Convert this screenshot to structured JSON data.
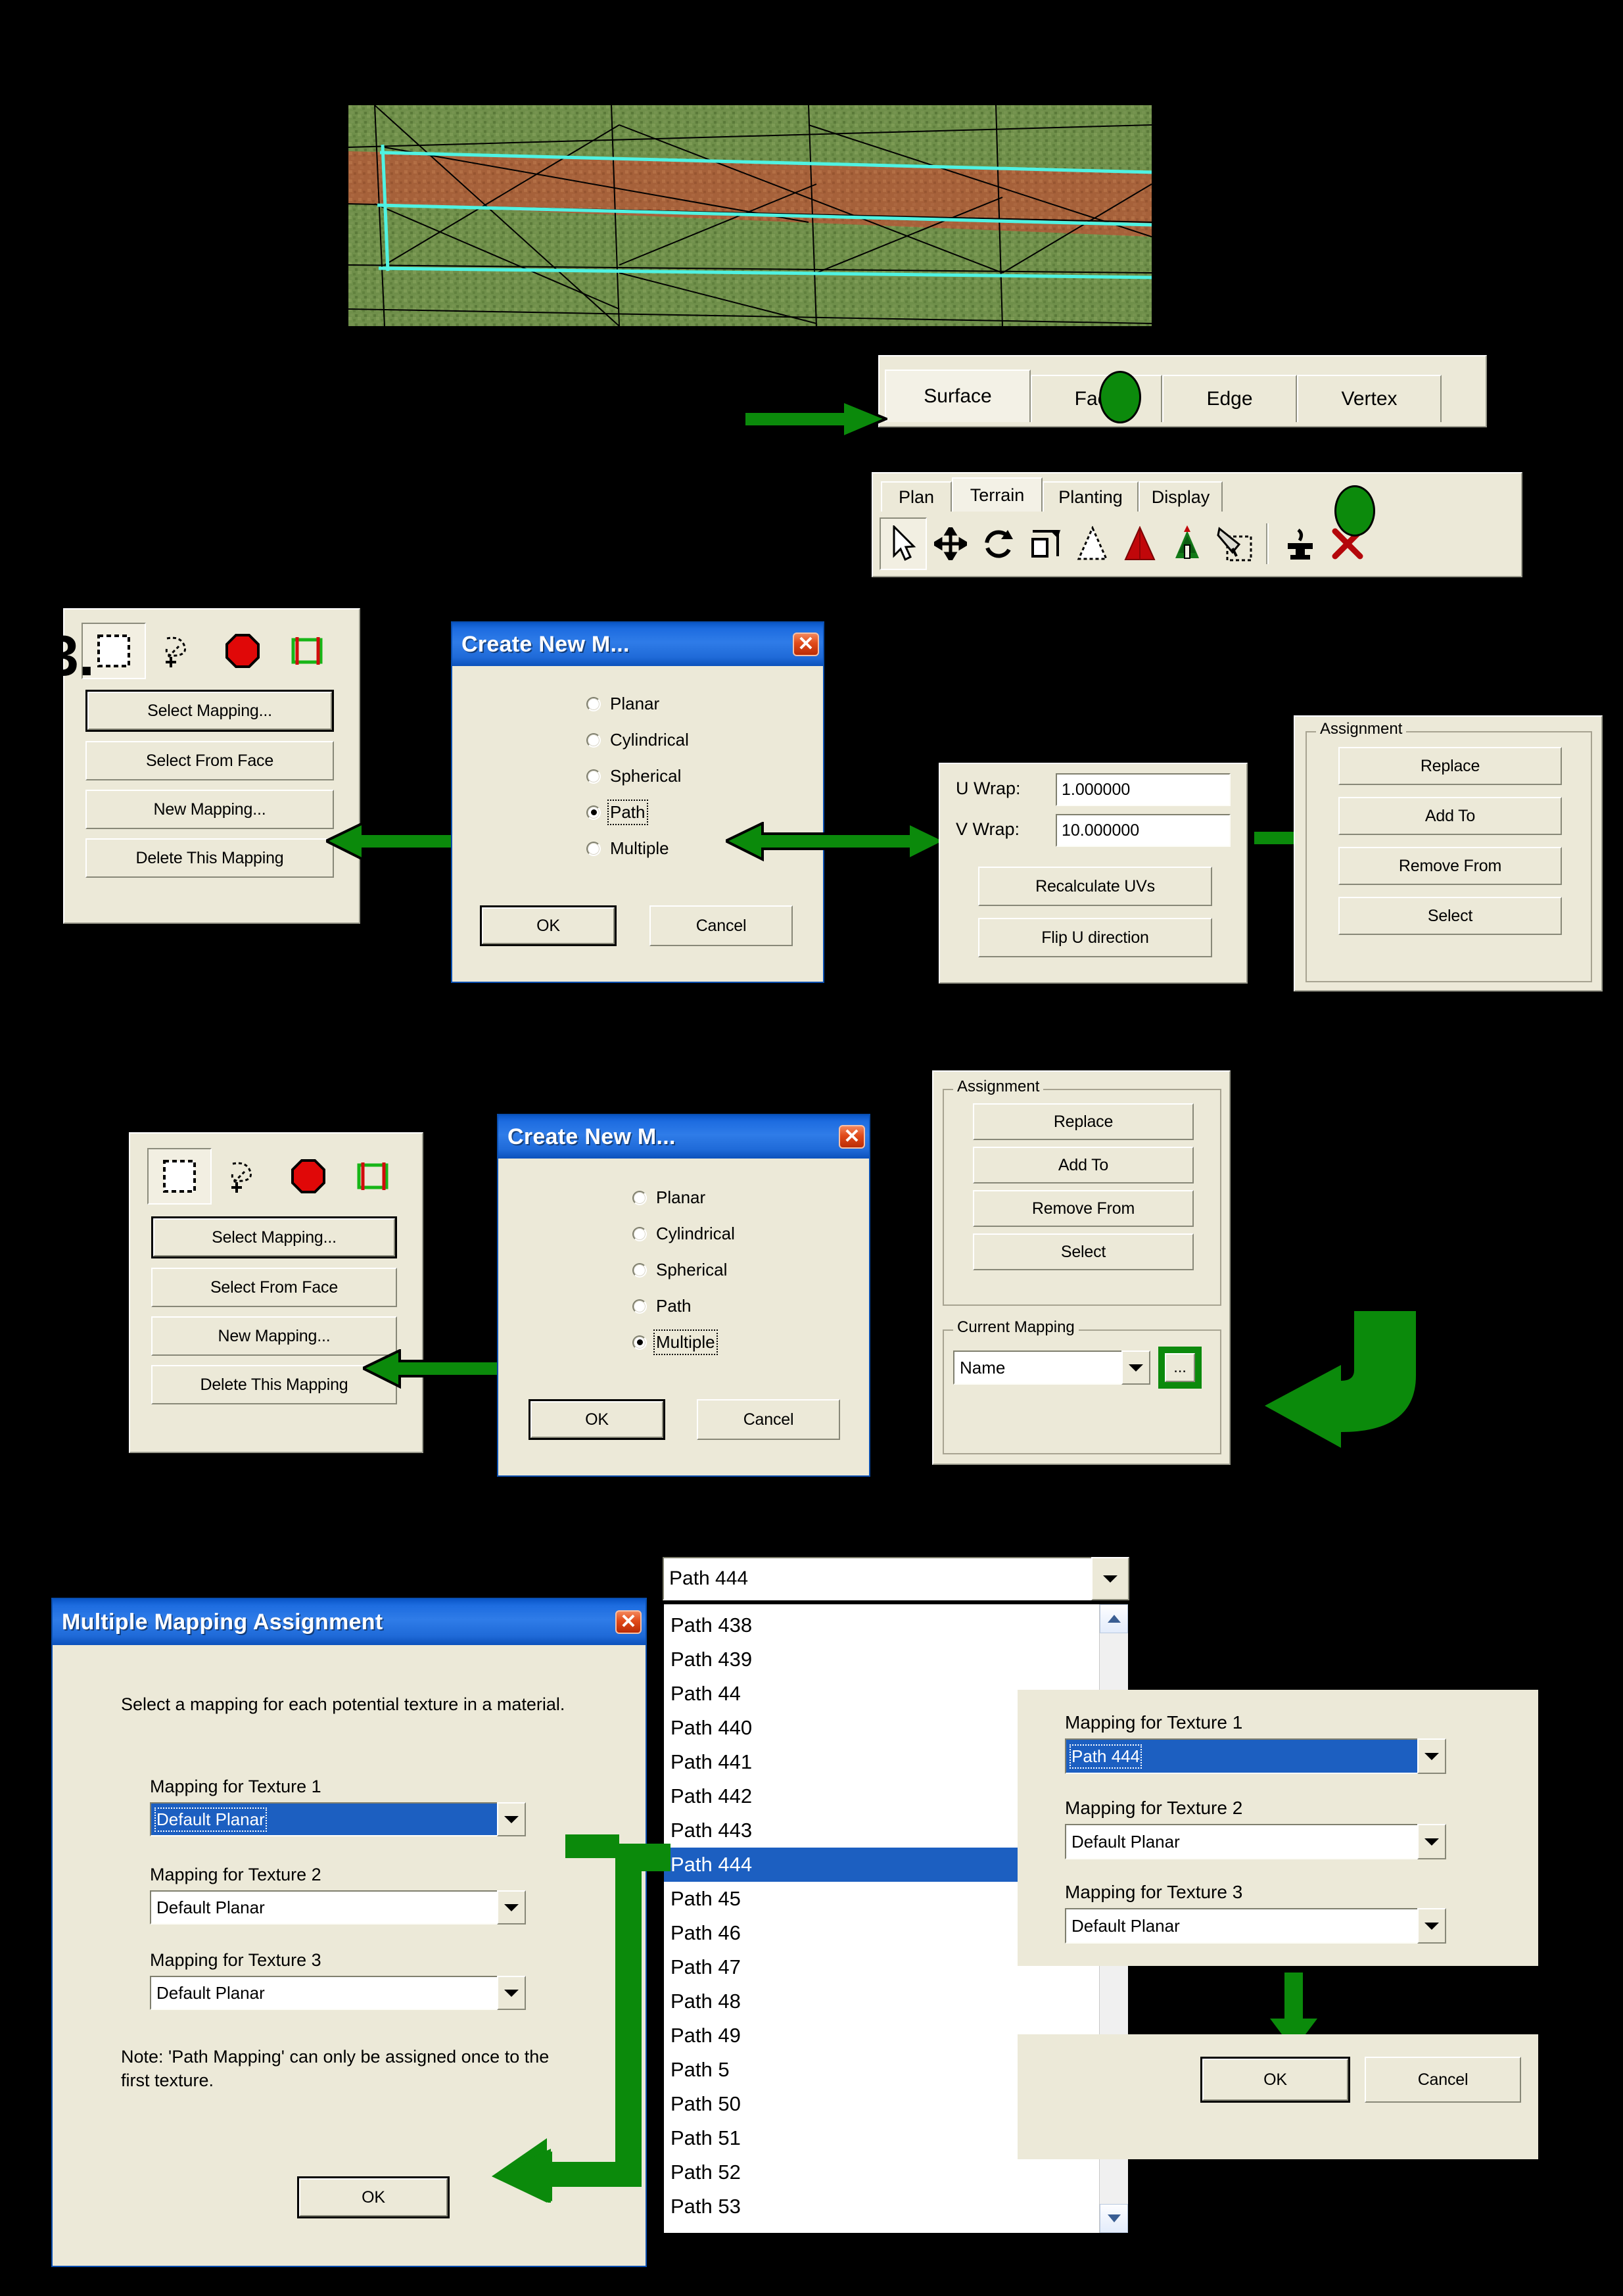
{
  "colors": {
    "arrow_green": "#0b8a0b",
    "dialog_face": "#ece9d8",
    "title_blue": "#1d6ce0",
    "selection_blue": "#1c5fc1",
    "grass_green": "#6f8f4a",
    "path_brown": "#a8603a",
    "wire_black": "#000000",
    "path_highlight_cyan": "#4ff2e2"
  },
  "terrain_view": {
    "name": "terrain-viewport",
    "description": "Grass terrain mesh with brown path band, black triangle wireframe and cyan highlighted path edges"
  },
  "subobject_tabs": {
    "name": "sub-object-mode-tabs",
    "items": [
      {
        "label": "Surface",
        "active": true
      },
      {
        "label": "Face",
        "active": false
      },
      {
        "label": "Edge",
        "active": false
      },
      {
        "label": "Vertex",
        "active": false
      }
    ]
  },
  "ribbon_tabs": {
    "items": [
      {
        "label": "Plan",
        "active": false
      },
      {
        "label": "Terrain",
        "active": true
      },
      {
        "label": "Planting",
        "active": false
      },
      {
        "label": "Display",
        "active": false
      }
    ]
  },
  "ribbon_tools": [
    {
      "icon": "select-arrow-icon"
    },
    {
      "icon": "move-icon"
    },
    {
      "icon": "rotate-icon"
    },
    {
      "icon": "scale-icon"
    },
    {
      "icon": "triangle-outline-icon"
    },
    {
      "icon": "red-triangle-icon"
    },
    {
      "icon": "tree-icon"
    },
    {
      "icon": "material-paint-icon"
    },
    {
      "icon": "anvil-icon"
    },
    {
      "icon": "delete-x-icon"
    }
  ],
  "mapping_panel": {
    "step_number": "3.",
    "mode_icons": [
      {
        "icon": "rectangle-select-icon",
        "pressed": true
      },
      {
        "icon": "lasso-add-select-icon",
        "pressed": false
      },
      {
        "icon": "red-octagon-icon",
        "pressed": false
      },
      {
        "icon": "mapping-gizmo-icon",
        "pressed": false
      }
    ],
    "buttons": [
      {
        "label": "Select Mapping...",
        "default": true
      },
      {
        "label": "Select From Face",
        "default": false
      },
      {
        "label": "New Mapping...",
        "default": false
      },
      {
        "label": "Delete This Mapping",
        "default": false
      }
    ]
  },
  "create_new_dialog_path": {
    "title": "Create New M...",
    "close_label": "✕",
    "options": [
      {
        "label": "Planar",
        "selected": false
      },
      {
        "label": "Cylindrical",
        "selected": false
      },
      {
        "label": "Spherical",
        "selected": false
      },
      {
        "label": "Path",
        "selected": true
      },
      {
        "label": "Multiple",
        "selected": false
      }
    ],
    "ok_label": "OK",
    "cancel_label": "Cancel"
  },
  "create_new_dialog_multiple": {
    "title": "Create New M...",
    "close_label": "✕",
    "options": [
      {
        "label": "Planar",
        "selected": false
      },
      {
        "label": "Cylindrical",
        "selected": false
      },
      {
        "label": "Spherical",
        "selected": false
      },
      {
        "label": "Path",
        "selected": false
      },
      {
        "label": "Multiple",
        "selected": true
      }
    ],
    "ok_label": "OK",
    "cancel_label": "Cancel"
  },
  "uv_panel": {
    "u_wrap_label": "U Wrap:",
    "u_wrap_value": "1.000000",
    "v_wrap_label": "V Wrap:",
    "v_wrap_value": "10.000000",
    "recalculate_label": "Recalculate UVs",
    "flip_label": "Flip U direction"
  },
  "assignment_panel_1": {
    "legend": "Assignment",
    "buttons": [
      "Replace",
      "Add To",
      "Remove From",
      "Select"
    ]
  },
  "assignment_panel_2": {
    "legend": "Assignment",
    "buttons": [
      "Replace",
      "Add To",
      "Remove From",
      "Select"
    ],
    "current_mapping_legend": "Current Mapping",
    "current_mapping_value": "Name",
    "browse_label": "..."
  },
  "multiple_mapping_dialog": {
    "title": "Multiple Mapping Assignment",
    "close_label": "✕",
    "instruction": "Select a mapping for each potential texture in a material.",
    "texture_rows": [
      {
        "label": "Mapping for Texture 1",
        "value": "Default Planar",
        "selected": true
      },
      {
        "label": "Mapping for Texture 2",
        "value": "Default Planar",
        "selected": false
      },
      {
        "label": "Mapping for Texture 3",
        "value": "Default Planar",
        "selected": false
      }
    ],
    "note": "Note: 'Path Mapping' can only be assigned once to the first texture.",
    "ok_label": "OK"
  },
  "path_dropdown": {
    "selected_value": "Path 444",
    "items": [
      {
        "label": "Path 438",
        "selected": false
      },
      {
        "label": "Path 439",
        "selected": false
      },
      {
        "label": "Path 44",
        "selected": false
      },
      {
        "label": "Path 440",
        "selected": false
      },
      {
        "label": "Path 441",
        "selected": false
      },
      {
        "label": "Path 442",
        "selected": false
      },
      {
        "label": "Path 443",
        "selected": false
      },
      {
        "label": "Path 444",
        "selected": true
      },
      {
        "label": "Path 45",
        "selected": false
      },
      {
        "label": "Path 46",
        "selected": false
      },
      {
        "label": "Path 47",
        "selected": false
      },
      {
        "label": "Path 48",
        "selected": false
      },
      {
        "label": "Path 49",
        "selected": false
      },
      {
        "label": "Path 5",
        "selected": false
      },
      {
        "label": "Path 50",
        "selected": false
      },
      {
        "label": "Path 51",
        "selected": false
      },
      {
        "label": "Path 52",
        "selected": false
      },
      {
        "label": "Path 53",
        "selected": false
      }
    ]
  },
  "result_panel": {
    "texture_rows": [
      {
        "label": "Mapping for Texture 1",
        "value": "Path 444",
        "selected": true
      },
      {
        "label": "Mapping for Texture 2",
        "value": "Default Planar",
        "selected": false
      },
      {
        "label": "Mapping for Texture 3",
        "value": "Default Planar",
        "selected": false
      }
    ],
    "ok_label": "OK",
    "cancel_label": "Cancel"
  }
}
